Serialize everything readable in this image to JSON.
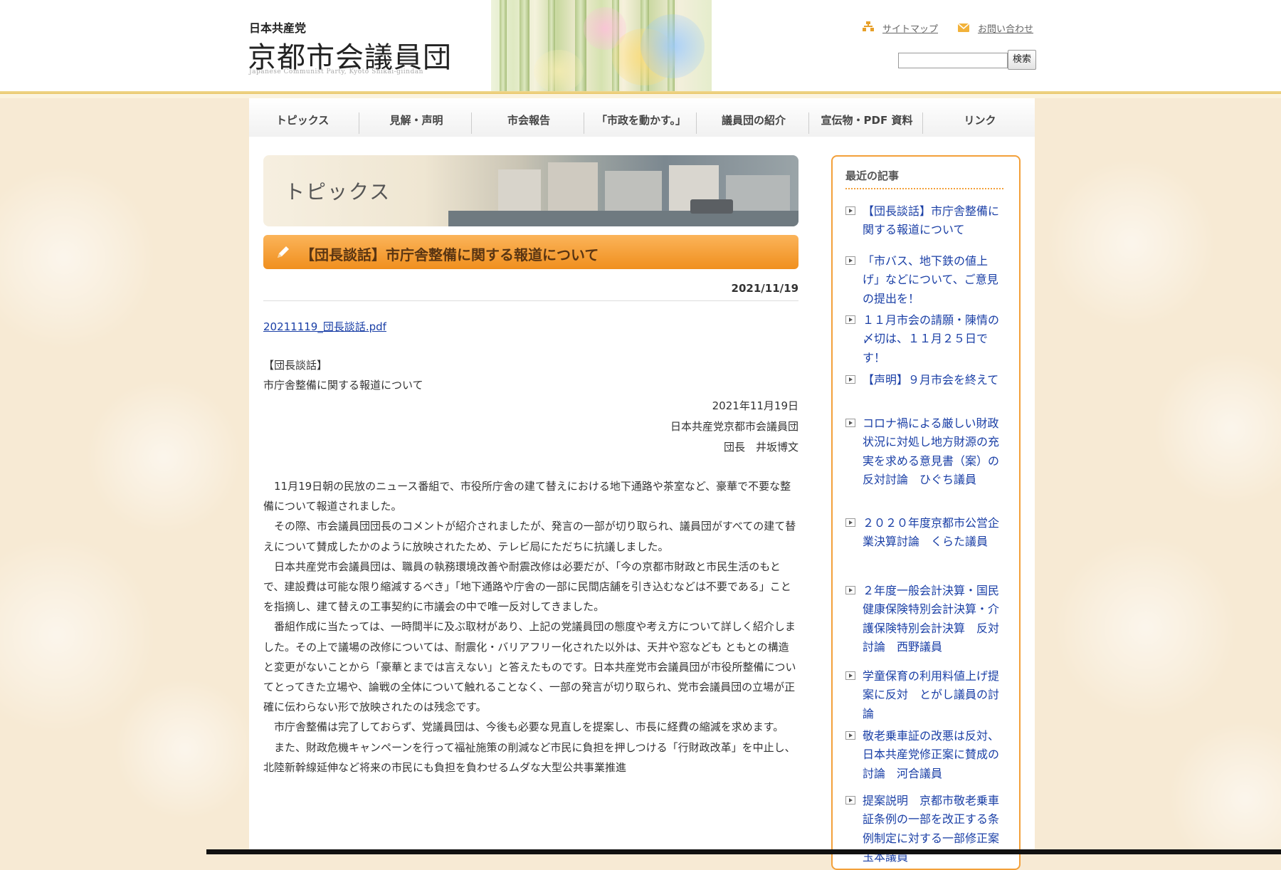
{
  "header": {
    "logo_small": "日本共産党",
    "logo_big": "京都市会議員団",
    "logo_en": "Japanese Communist Party, Kyoto Shikai-giindan",
    "links": [
      {
        "label": "サイトマップ",
        "icon": "sitemap-icon"
      },
      {
        "label": "お問い合わせ",
        "icon": "mail-icon"
      }
    ],
    "search": {
      "value": "",
      "button_label": "検索"
    }
  },
  "nav": {
    "items": [
      "トピックス",
      "見解・声明",
      "市会報告",
      "「市政を動かす。」",
      "議員団の紹介",
      "宣伝物・PDF 資料",
      "リンク"
    ]
  },
  "article": {
    "banner_title": "トピックス",
    "title": "【団長談話】市庁舎整備に関する報道について",
    "date": "2021/11/19",
    "pdf_link": "20211119_団長談話.pdf",
    "heading1": "【団長談話】",
    "heading2": "市庁舎整備に関する報道について",
    "sign_date": "2021年11月19日",
    "sign_org": "日本共産党京都市会議員団",
    "sign_name": "団長　井坂博文",
    "paragraphs": [
      "11月19日朝の民放のニュース番組で、市役所庁舎の建て替えにおける地下通路や茶室など、豪華で不要な整備について報道されました。",
      "その際、市会議員団団長のコメントが紹介されましたが、発言の一部が切り取られ、議員団がすべての建て替えについて賛成したかのように放映されたため、テレビ局にただちに抗議しました。",
      "日本共産党市会議員団は、職員の執務環境改善や耐震改修は必要だが、「今の京都市財政と市民生活のもとで、建設費は可能な限り縮減するべき」「地下通路や庁舎の一部に民間店舗を引き込むなどは不要である」ことを指摘し、建て替えの工事契約に市議会の中で唯一反対してきました。",
      "番組作成に当たっては、一時間半に及ぶ取材があり、上記の党議員団の態度や考え方について詳しく紹介しました。その上で議場の改修については、耐震化・バリアフリー化された以外は、天井や窓なども ともとの構造と変更がないことから「豪華とまでは言えない」と答えたものです。日本共産党市会議員団が市役所整備についてとってきた立場や、論戦の全体について触れることなく、一部の発言が切り取られ、党市会議員団の立場が正確に伝わらない形で放映されたのは残念です。",
      "市庁舎整備は完了しておらず、党議員団は、今後も必要な見直しを提案し、市長に経費の縮減を求めます。",
      "また、財政危機キャンペーンを行って福祉施策の削減など市民に負担を押しつける「行財政改革」を中止し、北陸新幹線延伸など将来の市民にも負担を負わせるムダな大型公共事業推進"
    ]
  },
  "sidebar": {
    "title": "最近の記事",
    "items": [
      "【団長談話】市庁舎整備に関する報道について",
      "「市バス、地下鉄の値上げ」などについて、ご意見の提出を！",
      "１１月市会の請願・陳情の〆切は、１１月２５日です！",
      "【声明】９月市会を終えて",
      "コロナ禍による厳しい財政状況に対処し地方財源の充実を求める意見書（案）の反対討論　ひぐち議員",
      "２０２０年度京都市公営企業決算討論　くらた議員",
      "２年度一般会計決算・国民健康保険特別会計決算・介護保険特別会計決算　反対討論　西野議員",
      "学童保育の利用料値上げ提案に反対　とがし議員の討論",
      "敬老乗車証の改悪は反対、日本共産党修正案に賛成の討論　河合議員",
      "提案説明　京都市敬老乗車証条例の一部を改正する条例制定に対する一部修正案　玉本議員"
    ]
  },
  "colors": {
    "accent_orange": "#f08f1e",
    "link_blue": "#1a3fa6",
    "bg_beige": "#f7ead4"
  }
}
